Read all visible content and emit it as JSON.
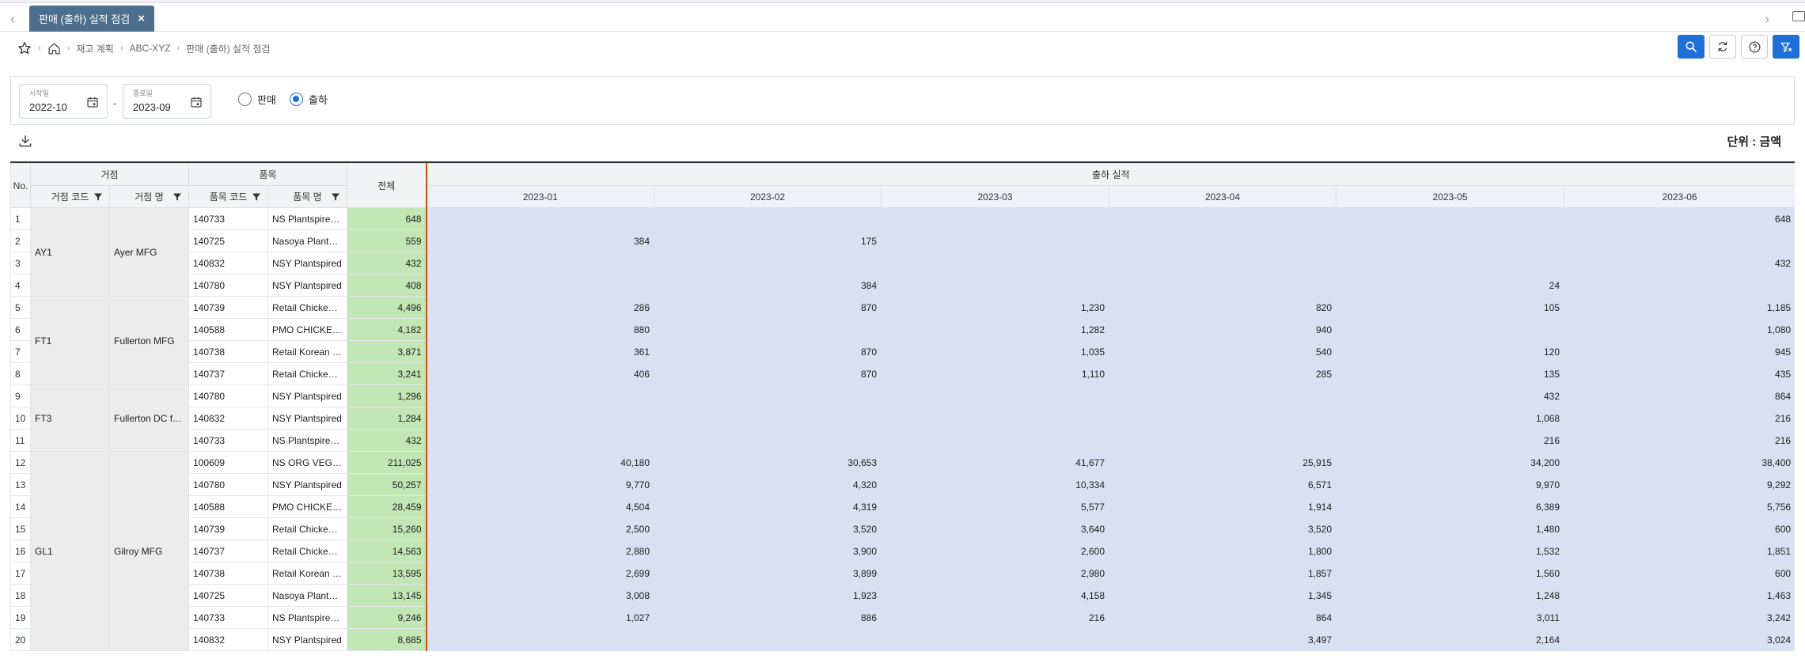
{
  "tab": {
    "label": "판매 (출하) 실적 점검",
    "close": "×"
  },
  "breadcrumb": [
    "재고 계획",
    "ABC-XYZ",
    "판매 (출하) 실적 점검"
  ],
  "filter": {
    "start": {
      "label": "시작일",
      "value": "2022-10"
    },
    "end": {
      "label": "종료일",
      "value": "2023-09"
    },
    "dash": "-",
    "radio": [
      {
        "label": "판매",
        "selected": false
      },
      {
        "label": "출하",
        "selected": true
      }
    ]
  },
  "unit": "단위 : 금액",
  "table": {
    "headers": {
      "no": "No.",
      "site_group": "거점",
      "site_code": "거점 코드",
      "site_name": "거점 명",
      "item_group": "품목",
      "item_code": "품목 코드",
      "item_name": "품목 명",
      "total": "전체",
      "actual": "출하 실적",
      "months": [
        "2023-01",
        "2023-02",
        "2023-03",
        "2023-04",
        "2023-05",
        "2023-06"
      ]
    },
    "groups": [
      {
        "code": "AY1",
        "name": "Ayer MFG",
        "rows": [
          {
            "no": "1",
            "item_code": "140733",
            "item_name": "NS Plantspired Chicken",
            "total": "648",
            "m": [
              "",
              "",
              "",
              "",
              "",
              "648"
            ]
          },
          {
            "no": "2",
            "item_code": "140725",
            "item_name": "Nasoya Plantspired",
            "total": "559",
            "m": [
              "384",
              "175",
              "",
              "",
              "",
              ""
            ]
          },
          {
            "no": "3",
            "item_code": "140832",
            "item_name": "NSY Plantspired",
            "total": "432",
            "m": [
              "",
              "",
              "",
              "",
              "",
              "432"
            ]
          },
          {
            "no": "4",
            "item_code": "140780",
            "item_name": "NSY Plantspired",
            "total": "408",
            "m": [
              "",
              "384",
              "",
              "",
              "24",
              ""
            ]
          }
        ]
      },
      {
        "code": "FT1",
        "name": "Fullerton MFG",
        "rows": [
          {
            "no": "5",
            "item_code": "140739",
            "item_name": "Retail Chicken Dumpling",
            "total": "4,496",
            "m": [
              "286",
              "870",
              "1,230",
              "820",
              "105",
              "1,185"
            ]
          },
          {
            "no": "6",
            "item_code": "140588",
            "item_name": "PMO CHICKEN DUMPLING",
            "total": "4,182",
            "m": [
              "880",
              "",
              "1,282",
              "940",
              "",
              "1,080"
            ]
          },
          {
            "no": "7",
            "item_code": "140738",
            "item_name": "Retail Korean Dumpling",
            "total": "3,871",
            "m": [
              "361",
              "870",
              "1,035",
              "540",
              "120",
              "945"
            ]
          },
          {
            "no": "8",
            "item_code": "140737",
            "item_name": "Retail Chicken Dumpling",
            "total": "3,241",
            "m": [
              "406",
              "870",
              "1,110",
              "285",
              "135",
              "435"
            ]
          }
        ]
      },
      {
        "code": "FT3",
        "name": "Fullerton DC facility",
        "rows": [
          {
            "no": "9",
            "item_code": "140780",
            "item_name": "NSY Plantspired",
            "total": "1,296",
            "m": [
              "",
              "",
              "",
              "",
              "432",
              "864"
            ]
          },
          {
            "no": "10",
            "item_code": "140832",
            "item_name": "NSY Plantspired",
            "total": "1,284",
            "m": [
              "",
              "",
              "",
              "",
              "1,068",
              "216"
            ]
          },
          {
            "no": "11",
            "item_code": "140733",
            "item_name": "NS Plantspired Chicken",
            "total": "432",
            "m": [
              "",
              "",
              "",
              "",
              "216",
              "216"
            ]
          }
        ]
      },
      {
        "code": "GL1",
        "name": "Gilroy MFG",
        "rows": [
          {
            "no": "12",
            "item_code": "100609",
            "item_name": "NS ORG VEGAN TOFU",
            "total": "211,025",
            "m": [
              "40,180",
              "30,653",
              "41,677",
              "25,915",
              "34,200",
              "38,400"
            ]
          },
          {
            "no": "13",
            "item_code": "140780",
            "item_name": "NSY Plantspired",
            "total": "50,257",
            "m": [
              "9,770",
              "4,320",
              "10,334",
              "6,571",
              "9,970",
              "9,292"
            ]
          },
          {
            "no": "14",
            "item_code": "140588",
            "item_name": "PMO CHICKEN DUMPLING",
            "total": "28,459",
            "m": [
              "4,504",
              "4,319",
              "5,577",
              "1,914",
              "6,389",
              "5,756"
            ]
          },
          {
            "no": "15",
            "item_code": "140739",
            "item_name": "Retail Chicken Dumpling",
            "total": "15,260",
            "m": [
              "2,500",
              "3,520",
              "3,640",
              "3,520",
              "1,480",
              "600"
            ]
          },
          {
            "no": "16",
            "item_code": "140737",
            "item_name": "Retail Chicken Dumpling",
            "total": "14,563",
            "m": [
              "2,880",
              "3,900",
              "2,600",
              "1,800",
              "1,532",
              "1,851"
            ]
          },
          {
            "no": "17",
            "item_code": "140738",
            "item_name": "Retail Korean Dumpling",
            "total": "13,595",
            "m": [
              "2,699",
              "3,899",
              "2,980",
              "1,857",
              "1,560",
              "600"
            ]
          },
          {
            "no": "18",
            "item_code": "140725",
            "item_name": "Nasoya Plantspired",
            "total": "13,145",
            "m": [
              "3,008",
              "1,923",
              "4,158",
              "1,345",
              "1,248",
              "1,463"
            ]
          },
          {
            "no": "19",
            "item_code": "140733",
            "item_name": "NS Plantspired Chicken",
            "total": "9,246",
            "m": [
              "1,027",
              "886",
              "216",
              "864",
              "3,011",
              "3,242"
            ]
          },
          {
            "no": "20",
            "item_code": "140832",
            "item_name": "NSY Plantspired",
            "total": "8,685",
            "m": [
              "",
              "",
              "",
              "3,497",
              "2,164",
              "3,024"
            ]
          }
        ]
      }
    ]
  },
  "icons": [
    "chevron-left-icon",
    "close-icon",
    "chevron-right-icon",
    "window-icon",
    "star-icon",
    "home-icon",
    "search-icon",
    "refresh-icon",
    "help-icon",
    "filter-clear-icon",
    "calendar-icon",
    "download-icon",
    "filter-icon"
  ],
  "colors": {
    "tab": "#4e6e8e",
    "primary": "#1e6fd9",
    "total_cell": "#c3e6b5",
    "month_cell": "#d9e0f1",
    "divider": "#d35400"
  }
}
